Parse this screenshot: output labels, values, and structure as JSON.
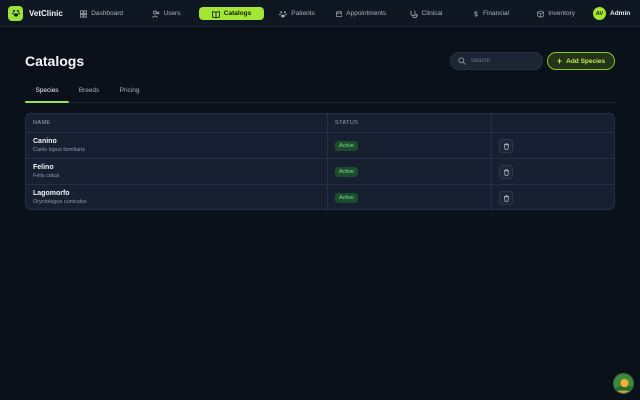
{
  "app": {
    "name": "VetClinic"
  },
  "nav": {
    "items": [
      {
        "label": "Dashboard",
        "icon": "grid-icon"
      },
      {
        "label": "Users",
        "icon": "users-icon"
      },
      {
        "label": "Catalogs",
        "icon": "book-icon"
      },
      {
        "label": "Patients",
        "icon": "paw-icon"
      },
      {
        "label": "Appointments",
        "icon": "calendar-icon"
      },
      {
        "label": "Clinical",
        "icon": "stethoscope-icon"
      },
      {
        "label": "Financial",
        "icon": "dollar-icon"
      },
      {
        "label": "Inventory",
        "icon": "box-icon"
      }
    ],
    "active": "Catalogs"
  },
  "user": {
    "initials": "AV",
    "label": "Admin"
  },
  "page": {
    "title": "Catalogs",
    "search_placeholder": "Search",
    "add_label": "Add Species"
  },
  "tabs": [
    {
      "label": "Species",
      "active": true
    },
    {
      "label": "Breeds",
      "active": false
    },
    {
      "label": "Pricing",
      "active": false
    }
  ],
  "table": {
    "columns": [
      "NAME",
      "STATUS"
    ],
    "rows": [
      {
        "name": "Canino",
        "scientific": "Canis lupus familiaris",
        "status": "Active"
      },
      {
        "name": "Felino",
        "scientific": "Felis catus",
        "status": "Active"
      },
      {
        "name": "Lagomorfo",
        "scientific": "Oryctolagus cuniculus",
        "status": "Active"
      }
    ]
  },
  "colors": {
    "accent": "#a3e635",
    "background": "#0b111b",
    "status_active": "#6ee38f"
  }
}
